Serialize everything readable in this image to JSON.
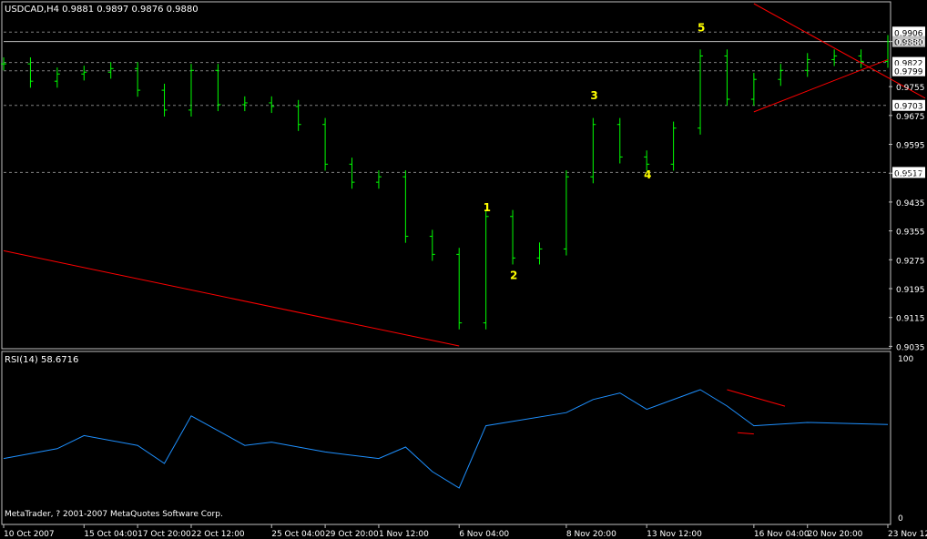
{
  "colors": {
    "background": "#000000",
    "frame": "#c0c0c0",
    "text": "#ffffff",
    "candle": "#00ff00",
    "rsi_line": "#1e90ff",
    "trendline": "#ff0000",
    "wave_label": "#ffff00",
    "gridline": "#808080"
  },
  "chart_data": [
    {
      "type": "line",
      "subtype": "ohlc-bar",
      "title": "USDCAD,H4  0.9881 0.9897 0.9876 0.9880",
      "symbol": "USDCAD",
      "timeframe": "H4",
      "ohlc_header": {
        "open": 0.9881,
        "high": 0.9897,
        "low": 0.9876,
        "close": 0.988
      },
      "ylim": [
        0.9036,
        0.9985
      ],
      "grid": false,
      "price_labels": [
        "0.9880",
        "0.9755",
        "0.9675",
        "0.9595",
        "0.9515",
        "0.9435",
        "0.9355",
        "0.9275",
        "0.9195",
        "0.9115",
        "0.9035"
      ],
      "highlighted_levels": [
        {
          "label": "0.9906",
          "value": 0.9906
        },
        {
          "label": "0.9880",
          "value": 0.988,
          "current": true
        },
        {
          "label": "0.9822",
          "value": 0.9822
        },
        {
          "label": "0.9799",
          "value": 0.9799
        },
        {
          "label": "0.9703",
          "value": 0.9703
        },
        {
          "label": "0.9517",
          "value": 0.9517
        }
      ],
      "series": [
        {
          "x": [
            "10 Oct 2007",
            "11 Oct 2007",
            "12 Oct 2007",
            "15 Oct 04:00",
            "16 Oct 2007",
            "17 Oct 20:00",
            "19 Oct 2007",
            "22 Oct 12:00",
            "23 Oct 2007",
            "24 Oct 2007",
            "25 Oct 04:00",
            "26 Oct 2007",
            "29 Oct 20:00",
            "31 Oct 2007",
            "1 Nov 12:00",
            "2 Nov 2007",
            "5 Nov 2007",
            "6 Nov 04:00",
            "6 Nov 20:00",
            "7 Nov 2007",
            "7 Nov 12:00",
            "8 Nov 20:00",
            "9 Nov 2007",
            "12 Nov 2007",
            "13 Nov 12:00",
            "13 Nov 20:00",
            "14 Nov 2007",
            "15 Nov 2007",
            "16 Nov 04:00",
            "19 Nov 2007",
            "20 Nov 20:00",
            "21 Nov 2007",
            "22 Nov 2007",
            "23 Nov 12:00"
          ],
          "close": [
            0.9818,
            0.977,
            0.979,
            0.9795,
            0.9805,
            0.9745,
            0.969,
            0.98,
            0.9705,
            0.971,
            0.97,
            0.965,
            0.954,
            0.949,
            0.9505,
            0.934,
            0.929,
            0.91,
            0.9395,
            0.928,
            0.9305,
            0.9505,
            0.965,
            0.956,
            0.954,
            0.964,
            0.984,
            0.972,
            0.9775,
            0.98,
            0.983,
            0.984,
            0.9825,
            0.988
          ]
        }
      ],
      "annotations": [
        {
          "text": "1",
          "value": 0.941
        },
        {
          "text": "2",
          "value": 0.9222
        },
        {
          "text": "3",
          "value": 0.972
        },
        {
          "text": "4",
          "value": 0.95
        },
        {
          "text": "5",
          "value": 0.9908
        }
      ],
      "trendlines": [
        {
          "name": "long-downtrend",
          "from": {
            "date": "10 Oct 2007",
            "price": 0.93
          },
          "to": {
            "date": "6 Nov 04:00",
            "price": 0.9036
          }
        },
        {
          "name": "triangle-top",
          "from": {
            "date": "16 Nov 04:00",
            "price": 0.9985
          },
          "to": {
            "date": "23 Nov 12:00",
            "price": 0.978
          }
        },
        {
          "name": "triangle-bottom",
          "from": {
            "date": "16 Nov 04:00",
            "price": 0.9685
          },
          "to": {
            "date": "23 Nov 12:00",
            "price": 0.983
          }
        }
      ],
      "xticks": [
        "10 Oct 2007",
        "15 Oct 04:00",
        "17 Oct 20:00",
        "22 Oct 12:00",
        "25 Oct 04:00",
        "29 Oct 20:00",
        "1 Nov 12:00",
        "6 Nov 04:00",
        "8 Nov 20:00",
        "13 Nov 12:00",
        "16 Nov 04:00",
        "20 Nov 20:00",
        "23 Nov 12:00"
      ]
    },
    {
      "type": "line",
      "title": "RSI(14) 58.6716",
      "indicator": "RSI(14)",
      "current_value": 58.6716,
      "ylim": [
        0,
        100
      ],
      "ytick_labels": [
        "100",
        "0"
      ],
      "grid": false,
      "series": [
        {
          "name": "RSI(14)",
          "x": [
            "10 Oct 2007",
            "12 Oct 2007",
            "15 Oct 04:00",
            "17 Oct 20:00",
            "19 Oct 2007",
            "22 Oct 12:00",
            "24 Oct 2007",
            "25 Oct 04:00",
            "29 Oct 20:00",
            "1 Nov 12:00",
            "2 Nov 2007",
            "5 Nov 2007",
            "6 Nov 04:00",
            "6 Nov 20:00",
            "8 Nov 20:00",
            "9 Nov 2007",
            "12 Nov 2007",
            "13 Nov 12:00",
            "14 Nov 2007",
            "15 Nov 2007",
            "16 Nov 04:00",
            "20 Nov 20:00",
            "23 Nov 12:00"
          ],
          "values": [
            38,
            44,
            52,
            46,
            35,
            64,
            46,
            48,
            42,
            38,
            45,
            30,
            20,
            58,
            66,
            74,
            78,
            68,
            80,
            70,
            58,
            60,
            58.7
          ]
        }
      ],
      "trendlines": [
        {
          "name": "rsi-top",
          "from": {
            "date": "15 Nov 2007",
            "value": 80
          },
          "to": {
            "date": "23 Nov 12:00",
            "value": 52
          }
        },
        {
          "name": "rsi-bottom",
          "from": {
            "date": "16 Nov 04:00",
            "value": 53
          },
          "to": {
            "date": "23 Nov 12:00",
            "value": 47
          }
        }
      ],
      "footer": "MetaTrader, ? 2001-2007 MetaQuotes Software Corp."
    }
  ]
}
